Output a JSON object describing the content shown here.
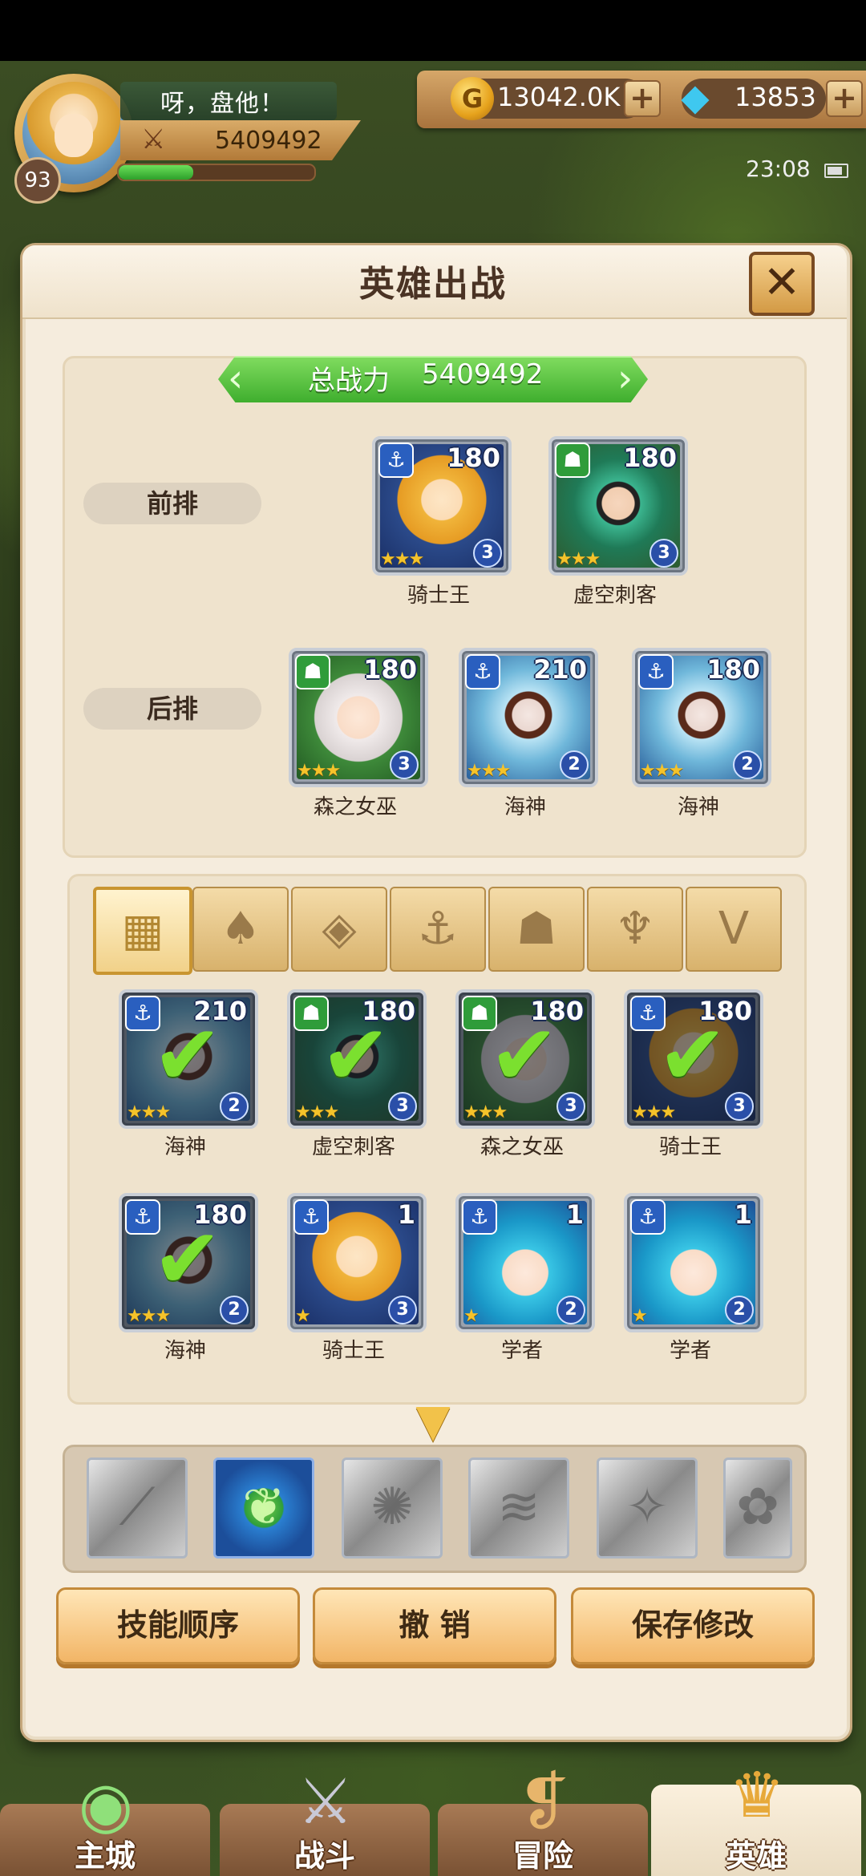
{
  "player": {
    "name": "呀，盘他！",
    "level": "93",
    "power": "5409492",
    "exp_fraction": 0.38
  },
  "currency": {
    "gold": "13042.0K",
    "gems": "13853",
    "plus": "+"
  },
  "system": {
    "clock": "23:08"
  },
  "modal": {
    "title": "英雄出战",
    "close_label": "✕",
    "total_power_label": "总战力",
    "total_power_value": "5409492"
  },
  "lineup": {
    "front_label": "前排",
    "back_label": "后排",
    "front": [
      {
        "name": "骑士王",
        "level": "180",
        "stars": "★★★",
        "rank": "3",
        "type": "anchor-icon"
      },
      {
        "name": "虚空刺客",
        "level": "180",
        "stars": "★★★",
        "rank": "3",
        "type": "beast-icon"
      }
    ],
    "back": [
      {
        "name": "森之女巫",
        "level": "180",
        "stars": "★★★",
        "rank": "3",
        "type": "beast-icon"
      },
      {
        "name": "海神",
        "level": "210",
        "stars": "★★★",
        "rank": "2",
        "type": "anchor-icon"
      },
      {
        "name": "海神",
        "level": "180",
        "stars": "★★★",
        "rank": "2",
        "type": "anchor-icon"
      }
    ]
  },
  "filters": [
    {
      "icon": "grid-icon",
      "glyph": "▦",
      "active": true
    },
    {
      "icon": "leaf-icon",
      "glyph": "♠",
      "active": false
    },
    {
      "icon": "diamond-icon",
      "glyph": "◈",
      "active": false
    },
    {
      "icon": "anchor-icon",
      "glyph": "⚓",
      "active": false
    },
    {
      "icon": "beast-icon",
      "glyph": "☗",
      "active": false
    },
    {
      "icon": "demon-icon",
      "glyph": "♆",
      "active": false
    },
    {
      "icon": "wing-icon",
      "glyph": "V",
      "active": false
    }
  ],
  "roster": [
    {
      "name": "海神",
      "level": "210",
      "stars": "★★★",
      "rank": "2",
      "selected": true
    },
    {
      "name": "虚空刺客",
      "level": "180",
      "stars": "★★★",
      "rank": "3",
      "selected": true
    },
    {
      "name": "森之女巫",
      "level": "180",
      "stars": "★★★",
      "rank": "3",
      "selected": true
    },
    {
      "name": "骑士王",
      "level": "180",
      "stars": "★★★",
      "rank": "3",
      "selected": true
    },
    {
      "name": "海神",
      "level": "180",
      "stars": "★★★",
      "rank": "2",
      "selected": true
    },
    {
      "name": "骑士王",
      "level": "1",
      "stars": "★",
      "rank": "3",
      "selected": false
    },
    {
      "name": "学者",
      "level": "1",
      "stars": "★",
      "rank": "2",
      "selected": false
    },
    {
      "name": "学者",
      "level": "1",
      "stars": "★",
      "rank": "2",
      "selected": false
    }
  ],
  "skills": [
    "skill-slash-icon",
    "skill-leaf-vortex-icon",
    "skill-gear-icon",
    "skill-wave-icon",
    "skill-beast-icon",
    "skill-spirit-icon"
  ],
  "actions": {
    "skill_order": "技能顺序",
    "undo": "撤 销",
    "save": "保存修改"
  },
  "nav": {
    "city": "主城",
    "battle": "战斗",
    "adventure": "冒险",
    "heroes": "英雄"
  }
}
